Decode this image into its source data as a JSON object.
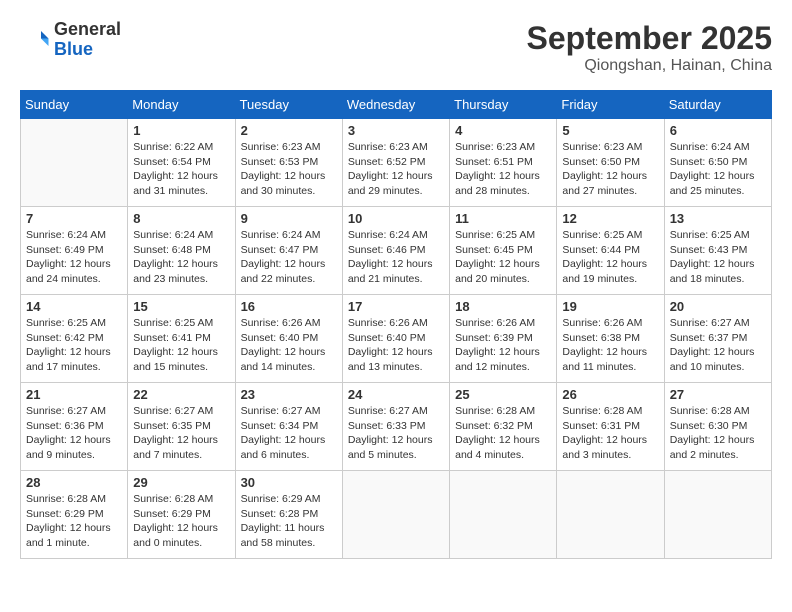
{
  "header": {
    "logo": {
      "general": "General",
      "blue": "Blue"
    },
    "title": "September 2025",
    "location": "Qiongshan, Hainan, China"
  },
  "calendar": {
    "weekdays": [
      "Sunday",
      "Monday",
      "Tuesday",
      "Wednesday",
      "Thursday",
      "Friday",
      "Saturday"
    ],
    "weeks": [
      [
        {
          "day": "",
          "info": ""
        },
        {
          "day": "1",
          "info": "Sunrise: 6:22 AM\nSunset: 6:54 PM\nDaylight: 12 hours\nand 31 minutes."
        },
        {
          "day": "2",
          "info": "Sunrise: 6:23 AM\nSunset: 6:53 PM\nDaylight: 12 hours\nand 30 minutes."
        },
        {
          "day": "3",
          "info": "Sunrise: 6:23 AM\nSunset: 6:52 PM\nDaylight: 12 hours\nand 29 minutes."
        },
        {
          "day": "4",
          "info": "Sunrise: 6:23 AM\nSunset: 6:51 PM\nDaylight: 12 hours\nand 28 minutes."
        },
        {
          "day": "5",
          "info": "Sunrise: 6:23 AM\nSunset: 6:50 PM\nDaylight: 12 hours\nand 27 minutes."
        },
        {
          "day": "6",
          "info": "Sunrise: 6:24 AM\nSunset: 6:50 PM\nDaylight: 12 hours\nand 25 minutes."
        }
      ],
      [
        {
          "day": "7",
          "info": "Sunrise: 6:24 AM\nSunset: 6:49 PM\nDaylight: 12 hours\nand 24 minutes."
        },
        {
          "day": "8",
          "info": "Sunrise: 6:24 AM\nSunset: 6:48 PM\nDaylight: 12 hours\nand 23 minutes."
        },
        {
          "day": "9",
          "info": "Sunrise: 6:24 AM\nSunset: 6:47 PM\nDaylight: 12 hours\nand 22 minutes."
        },
        {
          "day": "10",
          "info": "Sunrise: 6:24 AM\nSunset: 6:46 PM\nDaylight: 12 hours\nand 21 minutes."
        },
        {
          "day": "11",
          "info": "Sunrise: 6:25 AM\nSunset: 6:45 PM\nDaylight: 12 hours\nand 20 minutes."
        },
        {
          "day": "12",
          "info": "Sunrise: 6:25 AM\nSunset: 6:44 PM\nDaylight: 12 hours\nand 19 minutes."
        },
        {
          "day": "13",
          "info": "Sunrise: 6:25 AM\nSunset: 6:43 PM\nDaylight: 12 hours\nand 18 minutes."
        }
      ],
      [
        {
          "day": "14",
          "info": "Sunrise: 6:25 AM\nSunset: 6:42 PM\nDaylight: 12 hours\nand 17 minutes."
        },
        {
          "day": "15",
          "info": "Sunrise: 6:25 AM\nSunset: 6:41 PM\nDaylight: 12 hours\nand 15 minutes."
        },
        {
          "day": "16",
          "info": "Sunrise: 6:26 AM\nSunset: 6:40 PM\nDaylight: 12 hours\nand 14 minutes."
        },
        {
          "day": "17",
          "info": "Sunrise: 6:26 AM\nSunset: 6:40 PM\nDaylight: 12 hours\nand 13 minutes."
        },
        {
          "day": "18",
          "info": "Sunrise: 6:26 AM\nSunset: 6:39 PM\nDaylight: 12 hours\nand 12 minutes."
        },
        {
          "day": "19",
          "info": "Sunrise: 6:26 AM\nSunset: 6:38 PM\nDaylight: 12 hours\nand 11 minutes."
        },
        {
          "day": "20",
          "info": "Sunrise: 6:27 AM\nSunset: 6:37 PM\nDaylight: 12 hours\nand 10 minutes."
        }
      ],
      [
        {
          "day": "21",
          "info": "Sunrise: 6:27 AM\nSunset: 6:36 PM\nDaylight: 12 hours\nand 9 minutes."
        },
        {
          "day": "22",
          "info": "Sunrise: 6:27 AM\nSunset: 6:35 PM\nDaylight: 12 hours\nand 7 minutes."
        },
        {
          "day": "23",
          "info": "Sunrise: 6:27 AM\nSunset: 6:34 PM\nDaylight: 12 hours\nand 6 minutes."
        },
        {
          "day": "24",
          "info": "Sunrise: 6:27 AM\nSunset: 6:33 PM\nDaylight: 12 hours\nand 5 minutes."
        },
        {
          "day": "25",
          "info": "Sunrise: 6:28 AM\nSunset: 6:32 PM\nDaylight: 12 hours\nand 4 minutes."
        },
        {
          "day": "26",
          "info": "Sunrise: 6:28 AM\nSunset: 6:31 PM\nDaylight: 12 hours\nand 3 minutes."
        },
        {
          "day": "27",
          "info": "Sunrise: 6:28 AM\nSunset: 6:30 PM\nDaylight: 12 hours\nand 2 minutes."
        }
      ],
      [
        {
          "day": "28",
          "info": "Sunrise: 6:28 AM\nSunset: 6:29 PM\nDaylight: 12 hours\nand 1 minute."
        },
        {
          "day": "29",
          "info": "Sunrise: 6:28 AM\nSunset: 6:29 PM\nDaylight: 12 hours\nand 0 minutes."
        },
        {
          "day": "30",
          "info": "Sunrise: 6:29 AM\nSunset: 6:28 PM\nDaylight: 11 hours\nand 58 minutes."
        },
        {
          "day": "",
          "info": ""
        },
        {
          "day": "",
          "info": ""
        },
        {
          "day": "",
          "info": ""
        },
        {
          "day": "",
          "info": ""
        }
      ]
    ]
  }
}
